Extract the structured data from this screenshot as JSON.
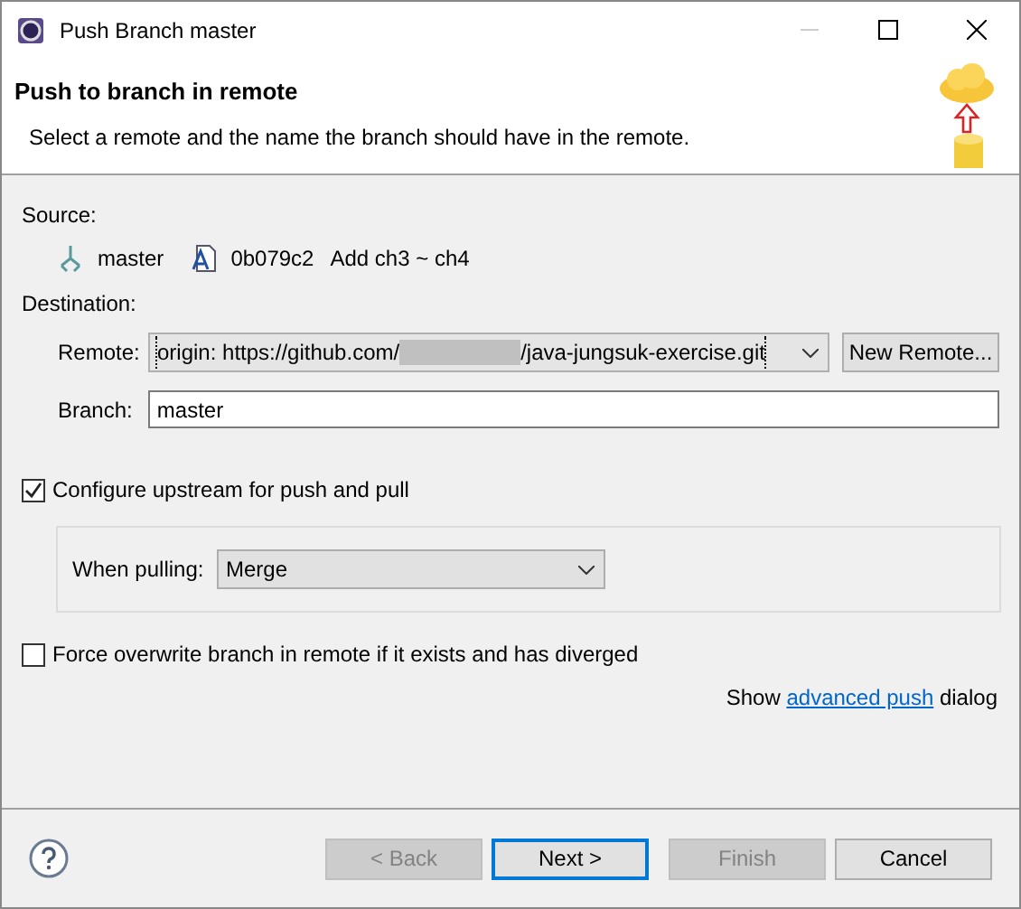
{
  "window": {
    "title": "Push Branch master"
  },
  "header": {
    "title": "Push to branch in remote",
    "description": "Select a remote and the name the branch should have in the remote."
  },
  "source": {
    "label": "Source:",
    "branch": "master",
    "commit_id": "0b079c2",
    "commit_message": "Add ch3 ~ ch4"
  },
  "destination": {
    "label": "Destination:",
    "remote_label": "Remote:",
    "remote_prefix": "origin: https://github.com/",
    "remote_suffix": "/java-jungsuk-exercise.git",
    "new_remote_button": "New Remote...",
    "branch_label": "Branch:",
    "branch_value": "master"
  },
  "configure_upstream": {
    "label": "Configure upstream for push and pull",
    "checked": true
  },
  "when_pulling": {
    "label": "When pulling:",
    "value": "Merge"
  },
  "force_overwrite": {
    "label": "Force overwrite branch in remote if it exists and has diverged",
    "checked": false
  },
  "advanced": {
    "before": "Show",
    "link": "advanced push",
    "after": "dialog"
  },
  "buttons": [
    {
      "label": "< Back",
      "disabled": true,
      "default": false
    },
    {
      "label": "Next >",
      "disabled": false,
      "default": true
    },
    {
      "label": "Finish",
      "disabled": true,
      "default": false
    },
    {
      "label": "Cancel",
      "disabled": false,
      "default": false
    }
  ]
}
